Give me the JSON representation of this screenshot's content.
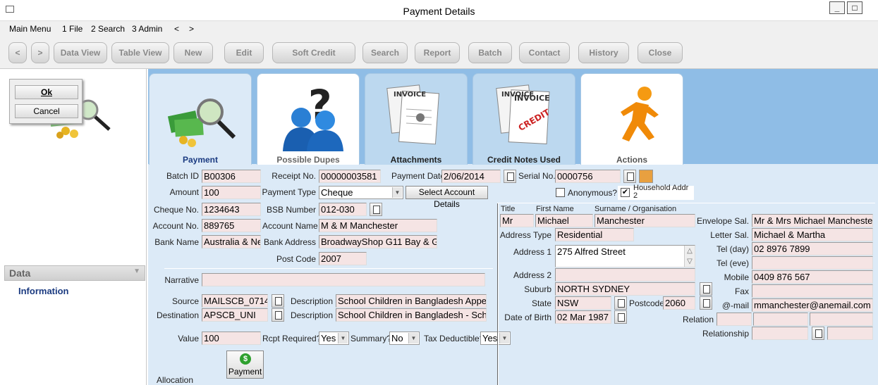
{
  "window": {
    "title": "Payment Details",
    "minimize": "_",
    "maximize": "□"
  },
  "menu": [
    "Main Menu",
    "1 File",
    "2 Search",
    "3 Admin",
    "<",
    ">"
  ],
  "toolbar": {
    "back": "<",
    "forward": ">",
    "buttons": [
      "Data View",
      "Table View",
      "New",
      "Edit",
      "Soft Credit",
      "Search",
      "Report",
      "Batch",
      "Contact",
      "History",
      "Close"
    ]
  },
  "dialog": {
    "ok": "Ok",
    "cancel": "Cancel"
  },
  "left": {
    "data_header": "Data",
    "info_link": "Information"
  },
  "tabs": [
    "Payment",
    "Possible Dupes",
    "Attachments",
    "Credit Notes Used",
    "Actions"
  ],
  "tab_images": {
    "attachments": "INVOICE",
    "credit_notes": "INVOICE",
    "credit_stamp": "CREDIT"
  },
  "form": {
    "batch_id": {
      "label": "Batch ID",
      "value": "B00306"
    },
    "receipt_no": {
      "label": "Receipt No.",
      "value": "00000003581"
    },
    "payment_date": {
      "label": "Payment Date",
      "value": "2/06/2014"
    },
    "serial_no": {
      "label": "Serial No.",
      "value": "0000756"
    },
    "amount": {
      "label": "Amount",
      "value": "100"
    },
    "payment_type": {
      "label": "Payment Type",
      "value": "Cheque"
    },
    "select_account": "Select Account Details",
    "anonymous": {
      "label": "Anonymous?",
      "checked": false
    },
    "household": {
      "label": "Household Addr 2",
      "checked": true,
      "mark": "✔"
    },
    "cheque_no": {
      "label": "Cheque No.",
      "value": "1234643"
    },
    "bsb_number": {
      "label": "BSB Number",
      "value": "012-030"
    },
    "account_no": {
      "label": "Account No.",
      "value": "889765"
    },
    "account_name": {
      "label": "Account Name",
      "value": "M & M Manchester"
    },
    "bank_name": {
      "label": "Bank Name",
      "value": "Australia & Ne"
    },
    "bank_address": {
      "label": "Bank Address",
      "value": "BroadwayShop G11  Bay & G"
    },
    "post_code": {
      "label": "Post Code",
      "value": "2007"
    },
    "narrative": {
      "label": "Narrative",
      "value": ""
    },
    "source": {
      "label": "Source",
      "value": "MAILSCB_0714"
    },
    "source_desc": {
      "label": "Description",
      "value": "School Children in Bangladesh Appe"
    },
    "destination": {
      "label": "Destination",
      "value": "APSCB_UNI"
    },
    "destination_desc": {
      "label": "Description",
      "value": "School Children in Bangladesh - Sch"
    },
    "value": {
      "label": "Value",
      "value": "100"
    },
    "rcpt_required": {
      "label": "Rcpt Required?",
      "value": "Yes"
    },
    "summary": {
      "label": "Summary?",
      "value": "No"
    },
    "tax_deductible": {
      "label": "Tax Deductible?",
      "value": "Yes"
    },
    "payment_button": "Payment",
    "payment_icon": "$",
    "allocation": "Allocation"
  },
  "contact": {
    "title_label": "Title",
    "first_name_label": "First Name",
    "surname_label": "Surname / Organisation",
    "title": "Mr",
    "first_name": "Michael",
    "surname": "Manchester",
    "address_type": {
      "label": "Address Type",
      "value": "Residential"
    },
    "address1": {
      "label": "Address 1",
      "value": "275 Alfred Street"
    },
    "address2": {
      "label": "Address 2",
      "value": ""
    },
    "suburb": {
      "label": "Suburb",
      "value": "NORTH SYDNEY"
    },
    "state": {
      "label": "State",
      "value": "NSW"
    },
    "postcode": {
      "label": "Postcode",
      "value": "2060"
    },
    "dob": {
      "label": "Date of Birth",
      "value": "02 Mar 1987"
    },
    "envelope_sal": {
      "label": "Envelope Sal.",
      "value": "Mr & Mrs Michael Manchester"
    },
    "letter_sal": {
      "label": "Letter Sal.",
      "value": "Michael & Martha"
    },
    "tel_day": {
      "label": "Tel (day)",
      "value": "02 8976 7899"
    },
    "tel_eve": {
      "label": "Tel (eve)",
      "value": ""
    },
    "mobile": {
      "label": "Mobile",
      "value": "0409 876 567"
    },
    "fax": {
      "label": "Fax",
      "value": ""
    },
    "email": {
      "label": "@-mail",
      "value": "mmanchester@anemail.com"
    },
    "relation": {
      "label": "Relation",
      "value": ""
    },
    "relationship": {
      "label": "Relationship",
      "value": ""
    }
  },
  "glyphs": {
    "dropdown": "▼",
    "scroll_up": "△",
    "scroll_down": "▽",
    "collapse": "▼"
  }
}
